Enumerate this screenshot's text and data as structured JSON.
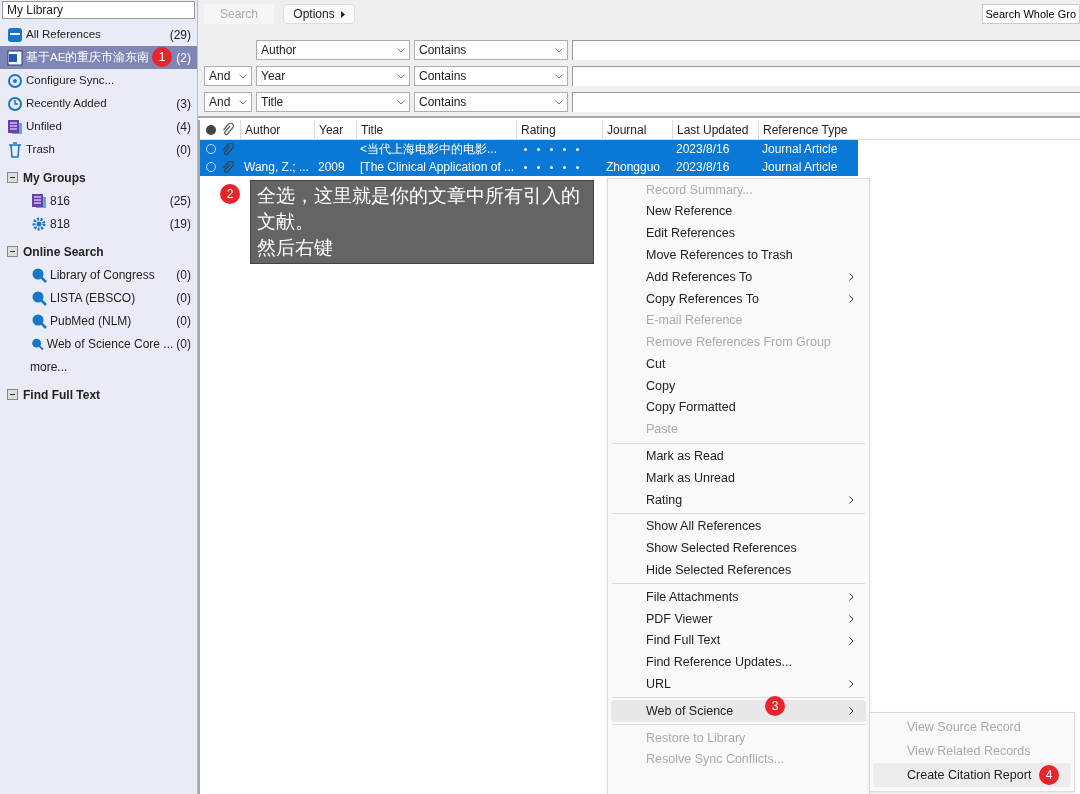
{
  "sidebar": {
    "header": "My Library",
    "items": [
      {
        "kind": "all",
        "label": "All References",
        "count": "(29)",
        "selected": false
      },
      {
        "kind": "document",
        "label": "基于AE的重庆市渝东南",
        "count": "(2)",
        "selected": true,
        "badge": "1"
      },
      {
        "kind": "sync",
        "label": "Configure Sync...",
        "selected": false
      },
      {
        "kind": "recent",
        "label": "Recently Added",
        "count": "(3)",
        "selected": false
      },
      {
        "kind": "unfiled",
        "label": "Unfiled",
        "count": "(4)",
        "selected": false
      },
      {
        "kind": "trash",
        "label": "Trash",
        "count": "(0)",
        "selected": false
      }
    ],
    "sections": [
      {
        "title": "My Groups",
        "expanded": true,
        "children": [
          {
            "kind": "list",
            "label": "816",
            "count": "(25)"
          },
          {
            "kind": "smart",
            "label": "818",
            "count": "(19)"
          }
        ]
      },
      {
        "title": "Online Search",
        "expanded": true,
        "children": [
          {
            "kind": "online",
            "label": "Library of Congress",
            "count": "(0)"
          },
          {
            "kind": "online",
            "label": "LISTA (EBSCO)",
            "count": "(0)"
          },
          {
            "kind": "online",
            "label": "PubMed (NLM)",
            "count": "(0)"
          },
          {
            "kind": "online",
            "label": "Web of Science Core ...",
            "count": "(0)"
          }
        ],
        "more": "more..."
      },
      {
        "title": "Find Full Text",
        "expanded": true
      }
    ]
  },
  "search": {
    "search_button": "Search",
    "options_button": "Options",
    "scope": "Search Whole Gro",
    "rows": [
      {
        "field": "Author",
        "operator": "Contains"
      },
      {
        "bool": "And",
        "field": "Year",
        "operator": "Contains"
      },
      {
        "bool": "And",
        "field": "Title",
        "operator": "Contains"
      }
    ]
  },
  "table": {
    "columns": [
      "Author",
      "Year",
      "Title",
      "Rating",
      "Journal",
      "Last Updated",
      "Reference Type"
    ],
    "rows": [
      {
        "selected": true,
        "cells": [
          "",
          "",
          "<当代上海电影中的电影...",
          "",
          "",
          "2023/8/16",
          "Journal Article"
        ]
      },
      {
        "selected": true,
        "cells": [
          "Wang, Z.; ...",
          "2009",
          "[The Clinical Application of ...",
          "",
          "Zhongguo",
          "2023/8/16",
          "Journal Article"
        ]
      }
    ]
  },
  "callout": {
    "badge": "2",
    "lines": [
      "全选，这里就是你的文章中所有引入的文献。",
      "然后右键"
    ]
  },
  "context_menu": {
    "items": [
      {
        "kind": "item",
        "label": "Record Summary...",
        "disabled": true,
        "submenu": false,
        "highlighted": false
      },
      {
        "kind": "item",
        "label": "New Reference",
        "disabled": false,
        "submenu": false,
        "highlighted": false
      },
      {
        "kind": "item",
        "label": "Edit References",
        "disabled": false,
        "submenu": false,
        "highlighted": false
      },
      {
        "kind": "item",
        "label": "Move References to Trash",
        "disabled": false,
        "submenu": false,
        "highlighted": false
      },
      {
        "kind": "item",
        "label": "Add References To",
        "disabled": false,
        "submenu": true,
        "highlighted": false
      },
      {
        "kind": "item",
        "label": "Copy References To",
        "disabled": false,
        "submenu": true,
        "highlighted": false
      },
      {
        "kind": "item",
        "label": "E-mail Reference",
        "disabled": true,
        "submenu": false,
        "highlighted": false
      },
      {
        "kind": "item",
        "label": "Remove References From Group",
        "disabled": true,
        "submenu": false,
        "highlighted": false
      },
      {
        "kind": "item",
        "label": "Cut",
        "disabled": false,
        "submenu": false,
        "highlighted": false
      },
      {
        "kind": "item",
        "label": "Copy",
        "disabled": false,
        "submenu": false,
        "highlighted": false
      },
      {
        "kind": "item",
        "label": "Copy Formatted",
        "disabled": false,
        "submenu": false,
        "highlighted": false
      },
      {
        "kind": "item",
        "label": "Paste",
        "disabled": true,
        "submenu": false,
        "highlighted": false
      },
      {
        "kind": "separator"
      },
      {
        "kind": "item",
        "label": "Mark as Read",
        "disabled": false,
        "submenu": false,
        "highlighted": false
      },
      {
        "kind": "item",
        "label": "Mark as Unread",
        "disabled": false,
        "submenu": false,
        "highlighted": false
      },
      {
        "kind": "item",
        "label": "Rating",
        "disabled": false,
        "submenu": true,
        "highlighted": false
      },
      {
        "kind": "separator"
      },
      {
        "kind": "item",
        "label": "Show All References",
        "disabled": false,
        "submenu": false,
        "highlighted": false
      },
      {
        "kind": "item",
        "label": "Show Selected References",
        "disabled": false,
        "submenu": false,
        "highlighted": false
      },
      {
        "kind": "item",
        "label": "Hide Selected References",
        "disabled": false,
        "submenu": false,
        "highlighted": false
      },
      {
        "kind": "separator"
      },
      {
        "kind": "item",
        "label": "File Attachments",
        "disabled": false,
        "submenu": true,
        "highlighted": false
      },
      {
        "kind": "item",
        "label": "PDF Viewer",
        "disabled": false,
        "submenu": true,
        "highlighted": false
      },
      {
        "kind": "item",
        "label": "Find Full Text",
        "disabled": false,
        "submenu": true,
        "highlighted": false
      },
      {
        "kind": "item",
        "label": "Find Reference Updates...",
        "disabled": false,
        "submenu": false,
        "highlighted": false
      },
      {
        "kind": "item",
        "label": "URL",
        "disabled": false,
        "submenu": true,
        "highlighted": false
      },
      {
        "kind": "separator"
      },
      {
        "kind": "item",
        "label": "Web of Science",
        "disabled": false,
        "submenu": true,
        "highlighted": true,
        "badge": "3"
      },
      {
        "kind": "separator"
      },
      {
        "kind": "item",
        "label": "Restore to Library",
        "disabled": true,
        "submenu": false,
        "highlighted": false
      },
      {
        "kind": "item",
        "label": "Resolve Sync Conflicts...",
        "disabled": true,
        "submenu": false,
        "highlighted": false
      }
    ]
  },
  "submenu": {
    "items": [
      {
        "label": "View Source Record",
        "disabled": true,
        "highlighted": false
      },
      {
        "label": "View Related Records",
        "disabled": true,
        "highlighted": false
      },
      {
        "label": "Create Citation Report",
        "disabled": false,
        "highlighted": true,
        "badge": "4"
      }
    ]
  }
}
